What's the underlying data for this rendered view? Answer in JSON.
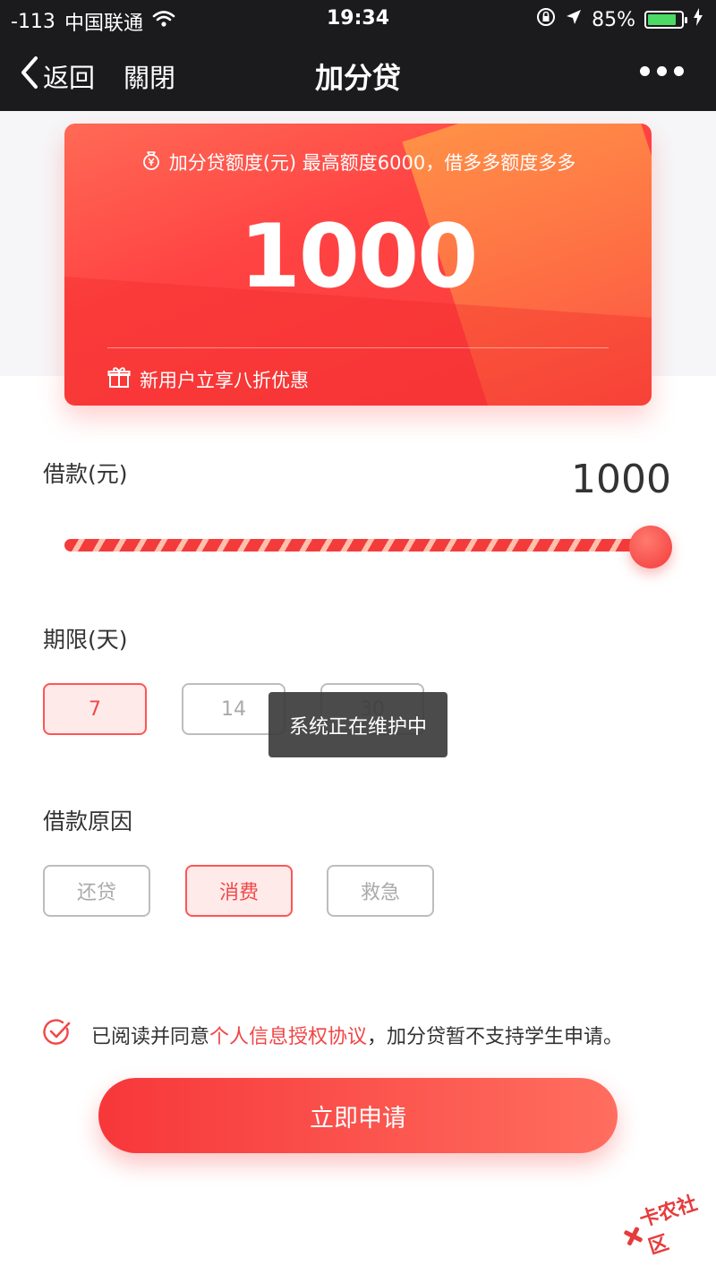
{
  "status_bar": {
    "signal": "-113",
    "carrier": "中国联通",
    "time": "19:34",
    "battery_percent": "85%",
    "battery_level": 0.85,
    "battery_color": "#4cd964"
  },
  "nav": {
    "back_label": "返回",
    "close_label": "關閉",
    "title": "加分贷"
  },
  "card": {
    "limit_text": "加分贷额度(元) 最高额度6000，借多多额度多多",
    "amount": "1000",
    "promo": "新用户立享八折优惠"
  },
  "loan": {
    "label": "借款(元)",
    "value": "1000",
    "slider_fraction": 1.0
  },
  "term": {
    "label": "期限(天)",
    "options": [
      "7",
      "14",
      "30"
    ],
    "selected": "7"
  },
  "reason": {
    "label": "借款原因",
    "options": [
      "还贷",
      "消费",
      "救急"
    ],
    "selected": "消费"
  },
  "toast": "系统正在维护中",
  "agreement": {
    "prefix": "已阅读并同意",
    "link": "个人信息授权协议",
    "suffix": "，加分贷暂不支持学生申请。",
    "checked": true
  },
  "submit_label": "立即申请",
  "watermark": "卡农社区",
  "accent_color": "#f04848"
}
